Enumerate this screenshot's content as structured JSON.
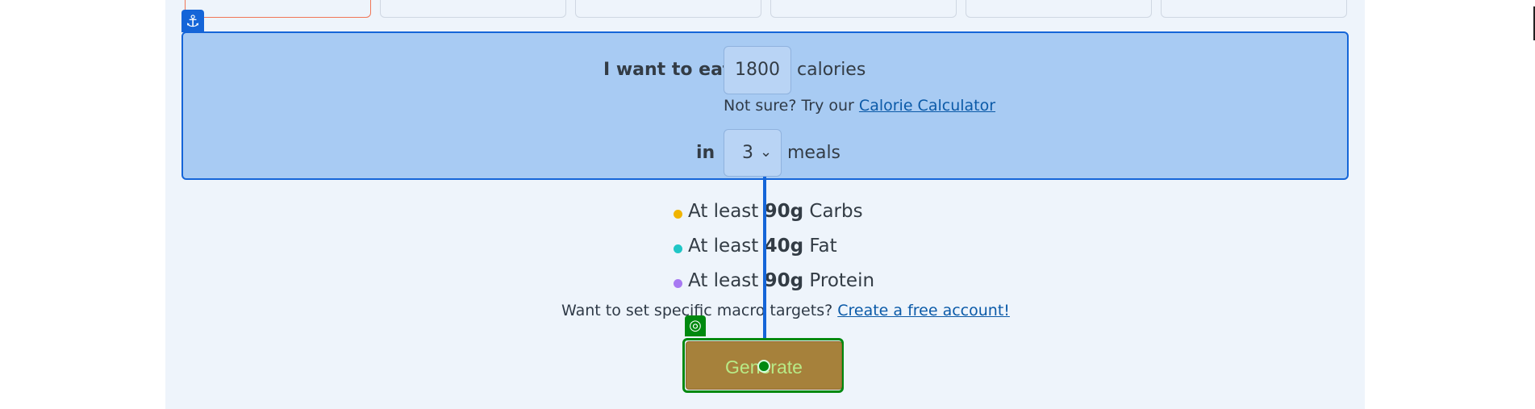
{
  "meal_plan": {
    "eat_label": "I want to eat",
    "calorie_value": "1800",
    "calories_unit": "calories",
    "not_sure_text": "Not sure? Try our",
    "calculator_link": "Calorie Calculator",
    "in_label": "in",
    "meals_value": "3",
    "meals_unit": "meals"
  },
  "macros": [
    {
      "prefix": "At least",
      "amount": "90g",
      "name": "Carbs",
      "color": "#f0b400"
    },
    {
      "prefix": "At least",
      "amount": "40g",
      "name": "Fat",
      "color": "#20c6c6"
    },
    {
      "prefix": "At least",
      "amount": "90g",
      "name": "Protein",
      "color": "#a779f2"
    }
  ],
  "account_prompt": {
    "text": "Want to set specific macro targets?",
    "link": "Create a free account!"
  },
  "actions": {
    "generate_label": "Generate"
  },
  "icons": {
    "anchor": "anchor-icon",
    "target": "target-icon",
    "cursor": "cursor-icon",
    "dropdown": "chevron-down-icon"
  },
  "colors": {
    "panel_background": "#eef4fb",
    "highlight_blue": "#1565d8",
    "highlight_fill": "#a8cbf3",
    "generate_button": "#a6813b",
    "target_green": "#00890f",
    "active_tab_border": "#f07656"
  }
}
